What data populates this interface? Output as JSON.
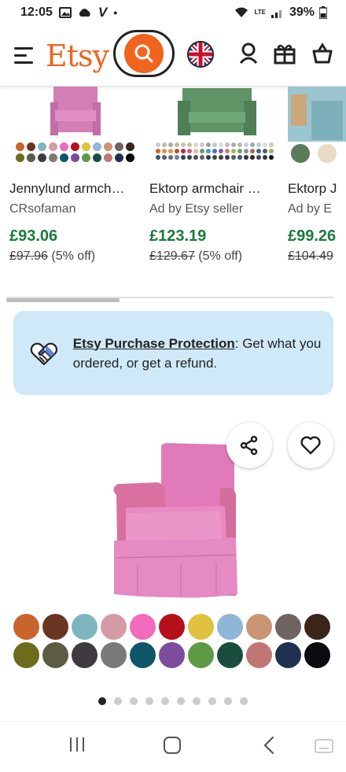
{
  "status": {
    "time": "12:05",
    "carrier_letter": "V",
    "dot": "•",
    "network": "LTE",
    "battery": "39%"
  },
  "header": {
    "logo": "Etsy"
  },
  "carousel": {
    "items": [
      {
        "title": "Jennylund armch…",
        "seller": "CRsofaman",
        "price": "£93.06",
        "original_price": "£97.96",
        "discount": "(5% off)",
        "color": "#d67fb8"
      },
      {
        "title": "Ektorp armchair …",
        "seller": "Ad by Etsy seller",
        "price": "£123.19",
        "original_price": "£129.67",
        "discount": "(5% off)",
        "color": "#5f9466"
      },
      {
        "title": "Ektorp J",
        "seller": "Ad by E",
        "price": "£99.26",
        "original_price": "£104.49",
        "discount": "",
        "color": "#8bb9c4"
      }
    ]
  },
  "protection": {
    "link_text": "Etsy Purchase Protection",
    "body_text": ": Get what you ordered, or get a refund."
  },
  "product": {
    "image_desc": "pink armchair cover",
    "swatch_colors_row1": [
      "#c9642d",
      "#6b3421",
      "#7eb6c0",
      "#d69aa5",
      "#f06bbb",
      "#b5111d",
      "#e0c140",
      "#8fb6d6",
      "#c99575",
      "#6f6460",
      "#3b2418"
    ],
    "swatch_colors_row2": [
      "#6c6d1c",
      "#5c5c45",
      "#3e3a3f",
      "#7a7a7a",
      "#0e5668",
      "#7b4d9c",
      "#5e9a45",
      "#1a4d3e",
      "#c27575",
      "#203050",
      "#0b0b0f"
    ]
  },
  "pager": {
    "count": 10,
    "active": 0
  }
}
